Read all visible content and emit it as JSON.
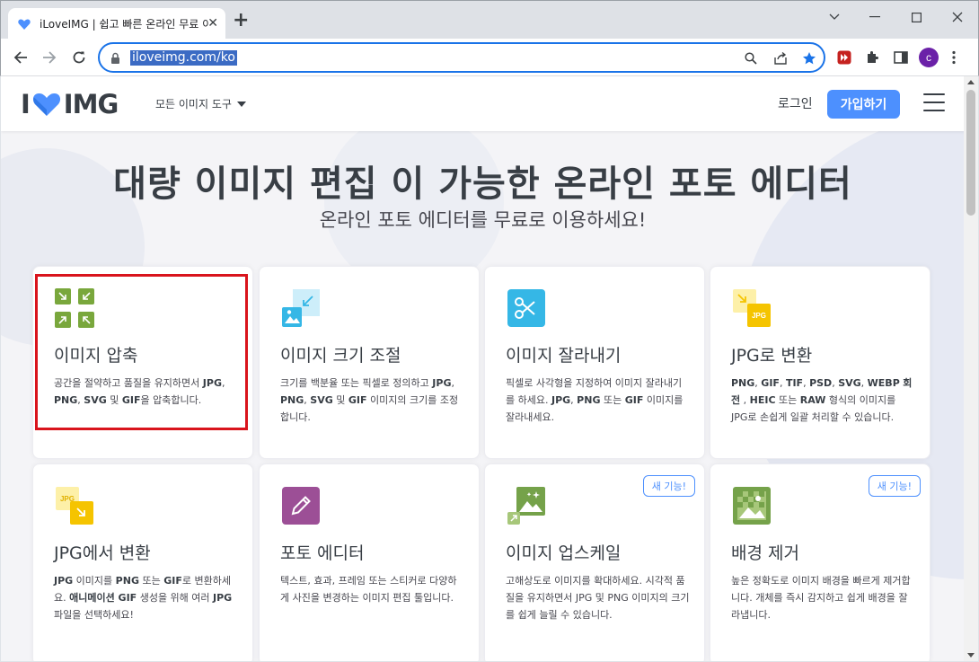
{
  "browser": {
    "tab_title": "iLoveIMG | 쉽고 빠른 온라인 무료 이미지 편집 도구",
    "url": "iloveimg.com/ko",
    "profile_initial": "c"
  },
  "header": {
    "logo_left": "I",
    "logo_right": "IMG",
    "tools_menu": "모든 이미지 도구",
    "login": "로그인",
    "signup": "가입하기"
  },
  "hero": {
    "title": "대량 이미지 편집 이 가능한 온라인 포토 에디터",
    "subtitle": "온라인 포토 에디터를 무료로 이용하세요!"
  },
  "cards": [
    {
      "title": "이미지 압축",
      "desc": [
        {
          "t": "공간을 절약하고 품질을 유지하면서 "
        },
        {
          "t": "JPG",
          "b": true
        },
        {
          "t": ", "
        },
        {
          "t": "PNG",
          "b": true
        },
        {
          "t": ", "
        },
        {
          "t": "SVG",
          "b": true
        },
        {
          "t": " 및 "
        },
        {
          "t": "GIF",
          "b": true
        },
        {
          "t": "을 압축합니다."
        }
      ]
    },
    {
      "title": "이미지 크기 조절",
      "desc": [
        {
          "t": "크기를 백분율 또는 픽셀로 정의하고 "
        },
        {
          "t": "JPG",
          "b": true
        },
        {
          "t": ", "
        },
        {
          "t": "PNG",
          "b": true
        },
        {
          "t": ", "
        },
        {
          "t": "SVG",
          "b": true
        },
        {
          "t": " 및 "
        },
        {
          "t": "GIF",
          "b": true
        },
        {
          "t": " 이미지의 크기를 조정합니다."
        }
      ]
    },
    {
      "title": "이미지 잘라내기",
      "desc": [
        {
          "t": "픽셀로 사각형을 지정하여 이미지 잘라내기를 하세요. "
        },
        {
          "t": "JPG",
          "b": true
        },
        {
          "t": ", "
        },
        {
          "t": "PNG",
          "b": true
        },
        {
          "t": " 또는 "
        },
        {
          "t": "GIF",
          "b": true
        },
        {
          "t": " 이미지를 잘라내세요."
        }
      ]
    },
    {
      "title": "JPG로 변환",
      "desc": [
        {
          "t": "PNG",
          "b": true
        },
        {
          "t": ", "
        },
        {
          "t": "GIF",
          "b": true
        },
        {
          "t": ", "
        },
        {
          "t": "TIF",
          "b": true
        },
        {
          "t": ", "
        },
        {
          "t": "PSD",
          "b": true
        },
        {
          "t": ", "
        },
        {
          "t": "SVG",
          "b": true
        },
        {
          "t": ", "
        },
        {
          "t": "WEBP",
          "b": true
        },
        {
          "t": " "
        },
        {
          "t": "회전",
          "b": true
        },
        {
          "t": " , "
        },
        {
          "t": "HEIC",
          "b": true
        },
        {
          "t": " 또는 "
        },
        {
          "t": "RAW",
          "b": true
        },
        {
          "t": " 형식의 이미지를 JPG로 손쉽게 일괄 처리할 수 있습니다."
        }
      ]
    },
    {
      "title": "JPG에서 변환",
      "desc": [
        {
          "t": "JPG",
          "b": true
        },
        {
          "t": " 이미지를 "
        },
        {
          "t": "PNG",
          "b": true
        },
        {
          "t": " 또는 "
        },
        {
          "t": "GIF",
          "b": true
        },
        {
          "t": "로 변환하세요. "
        },
        {
          "t": "애니메이션 GIF",
          "b": true
        },
        {
          "t": " 생성을 위해 여러 "
        },
        {
          "t": "JPG",
          "b": true
        },
        {
          "t": " 파일을 선택하세요!"
        }
      ]
    },
    {
      "title": "포토 에디터",
      "desc": [
        {
          "t": "텍스트, 효과, 프레임 또는 스티커로 다양하게 사진을 변경하는 이미지 편집 툴입니다."
        }
      ]
    },
    {
      "title": "이미지 업스케일",
      "badge": "새 기능!",
      "desc": [
        {
          "t": "고해상도로 이미지를 확대하세요. 시각적 품질을 유지하면서 JPG 및 PNG 이미지의 크기를 쉽게 늘릴 수 있습니다."
        }
      ]
    },
    {
      "title": "배경 제거",
      "badge": "새 기능!",
      "desc": [
        {
          "t": "높은 정확도로 이미지 배경을 빠르게 제거합니다. 개체를 즉시 감지하고 쉽게 배경을 잘라냅니다."
        }
      ]
    }
  ],
  "icons": {
    "compress": "compress-icon",
    "resize": "resize-icon",
    "crop": "scissors-icon",
    "to_jpg": "jpg-convert-icon",
    "from_jpg": "jpg-from-icon",
    "editor": "pencil-icon",
    "upscale": "upscale-icon",
    "remove_bg": "remove-background-icon"
  },
  "icon_labels": {
    "jpg": "JPG"
  },
  "colors": {
    "brand_red": "#e5322d",
    "signup_blue": "#4d90fe",
    "compress_green": "#79a73c",
    "resize_blue": "#35b7e6",
    "jpg_yellow": "#f5c400",
    "editor_purple": "#9c4f96",
    "upscale_green": "#75a24a",
    "highlight_red": "#d9141c"
  }
}
